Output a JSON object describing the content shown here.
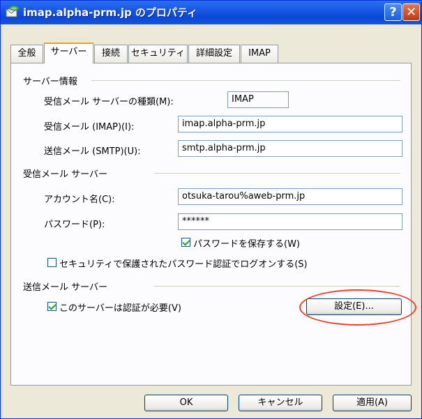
{
  "window": {
    "title": "imap.alpha-prm.jp のプロパティ",
    "help_label": "?",
    "close_label": "✕"
  },
  "tabs": [
    {
      "label": "全般"
    },
    {
      "label": "サーバー"
    },
    {
      "label": "接続"
    },
    {
      "label": "セキュリティ"
    },
    {
      "label": "詳細設定"
    },
    {
      "label": "IMAP"
    }
  ],
  "server_info": {
    "heading": "サーバー情報",
    "type_label": "受信メール サーバーの種類(M):",
    "type_value": "IMAP",
    "incoming_label": "受信メール (IMAP)(I):",
    "incoming_value": "imap.alpha-prm.jp",
    "outgoing_label": "送信メール (SMTP)(U):",
    "outgoing_value": "smtp.alpha-prm.jp"
  },
  "incoming_server": {
    "heading": "受信メール サーバー",
    "account_label": "アカウント名(C):",
    "account_value": "otsuka-tarou%aweb-prm.jp",
    "password_label": "パスワード(P):",
    "password_value": "******",
    "save_password_label": "パスワードを保存する(W)",
    "secure_auth_label": "セキュリティで保護されたパスワード認証でログオンする(S)"
  },
  "outgoing_server": {
    "heading": "送信メール サーバー",
    "auth_required_label": "このサーバーは認証が必要(V)",
    "settings_button": "設定(E)..."
  },
  "footer": {
    "ok": "OK",
    "cancel": "キャンセル",
    "apply": "適用(A)"
  },
  "colors": {
    "highlight_ellipse": "#e8442a",
    "titlebar": "#0a47d6"
  }
}
